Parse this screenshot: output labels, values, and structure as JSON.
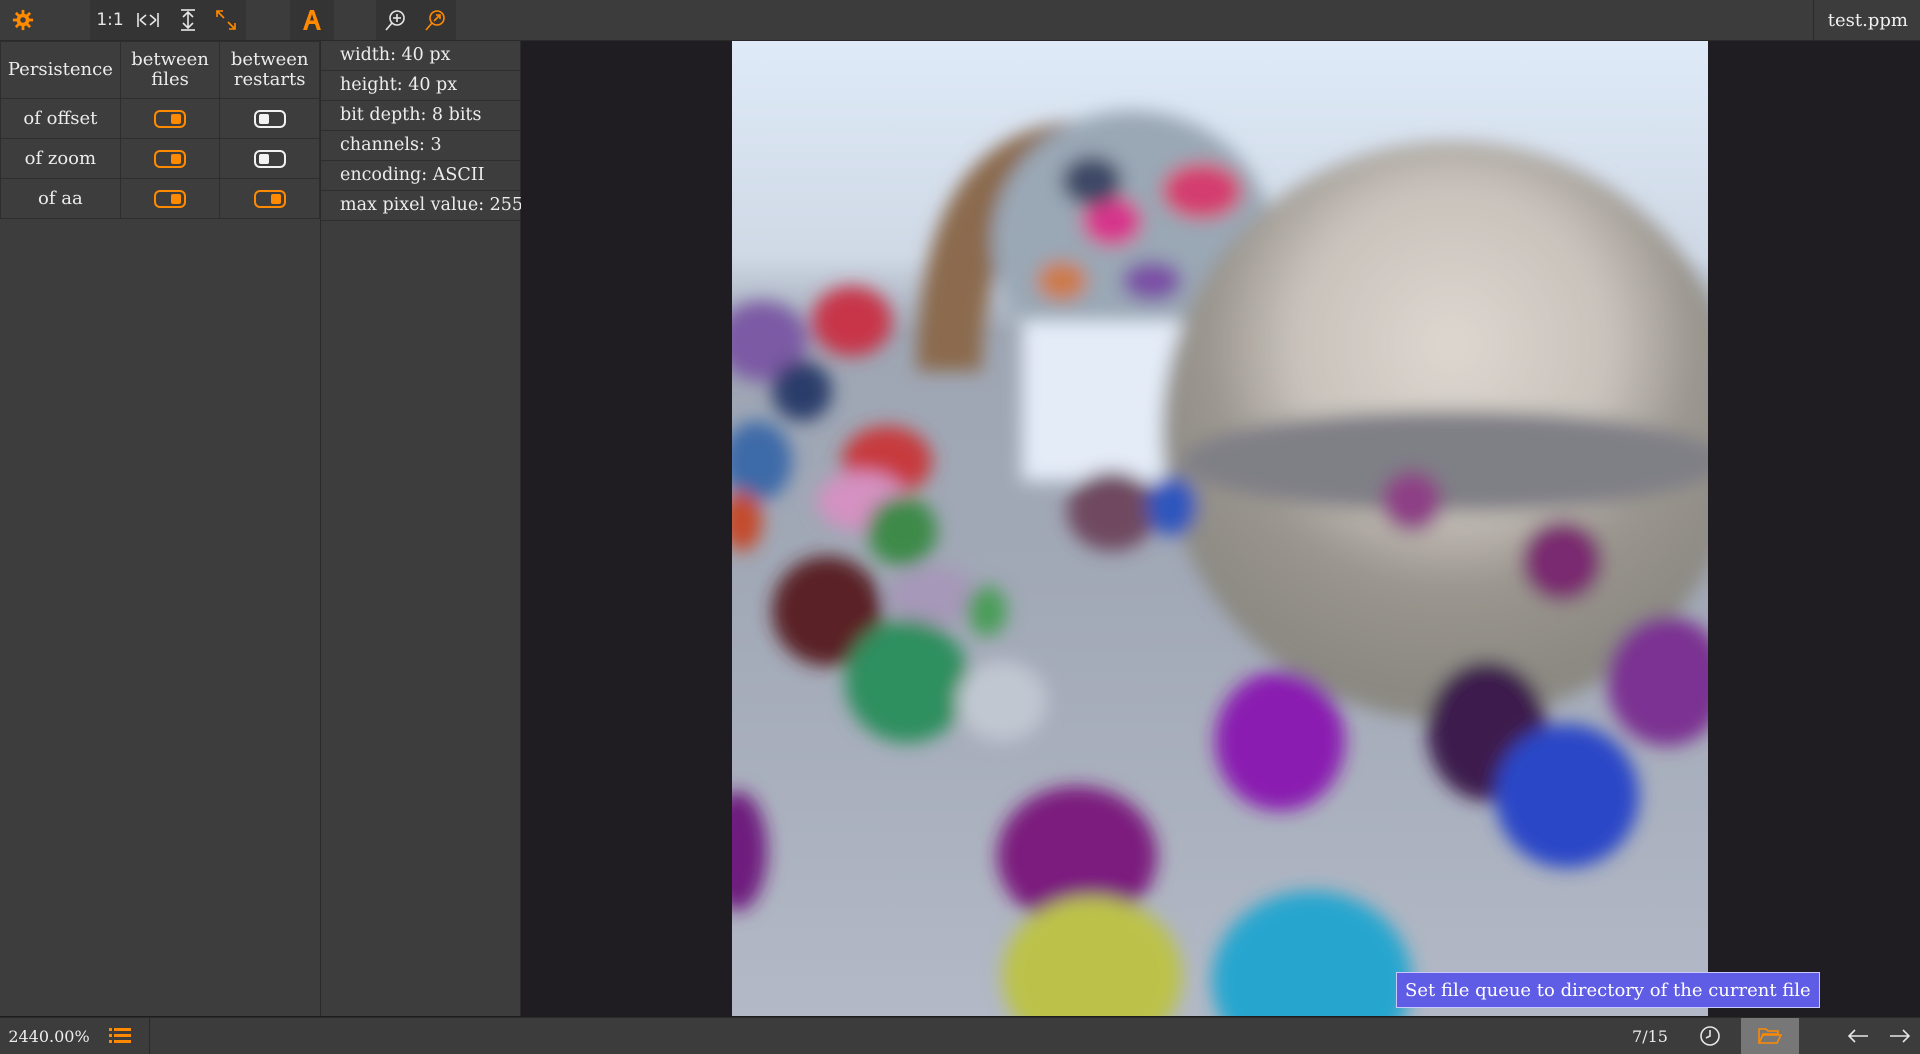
{
  "toolbar": {
    "zoom_one_to_one_label": "1:1",
    "icons": [
      "gear-icon",
      "fit-width-icon",
      "fit-height-icon",
      "fit-window-icon",
      "font-a-icon",
      "zoom-in-icon",
      "zoom-target-icon"
    ],
    "filename": "test.ppm"
  },
  "persistence": {
    "header": {
      "title": "Persistence",
      "col1": "between files",
      "col2": "between restarts"
    },
    "rows": [
      {
        "label": "of offset",
        "between_files": true,
        "between_restarts": false
      },
      {
        "label": "of zoom",
        "between_files": true,
        "between_restarts": false
      },
      {
        "label": "of aa",
        "between_files": true,
        "between_restarts": true
      }
    ]
  },
  "info": {
    "rows": [
      "width: 40 px",
      "height: 40 px",
      "bit depth: 8 bits",
      "channels: 3",
      "encoding: ASCII",
      "max pixel value: 255"
    ]
  },
  "tooltip": {
    "text": "Set file queue to directory of the current file"
  },
  "statusbar": {
    "zoom_level": "2440.00%",
    "queue_position": "7/15",
    "icons": [
      "list-icon",
      "clock-icon",
      "folder-icon",
      "arrow-left-icon",
      "arrow-right-icon"
    ]
  },
  "colors": {
    "accent": "#ff8a00",
    "panel_bg": "#3d3d3d",
    "viewport_bg": "#201d22",
    "tooltip_bg": "#5f5ce5"
  }
}
